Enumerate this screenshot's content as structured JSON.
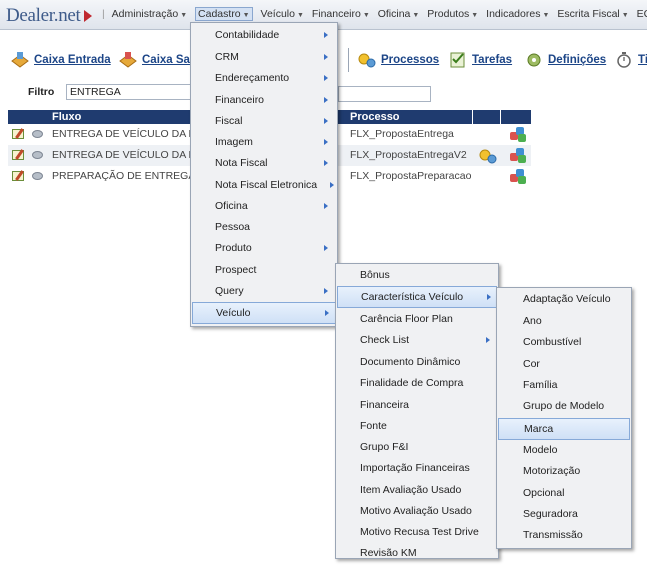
{
  "app": {
    "logo": "Dealer.net"
  },
  "nav": {
    "items": [
      {
        "label": "Administração",
        "caret": true
      },
      {
        "label": "Cadastro",
        "caret": true,
        "active": true
      },
      {
        "label": "Veículo",
        "caret": true
      },
      {
        "label": "Financeiro",
        "caret": true
      },
      {
        "label": "Oficina",
        "caret": true
      },
      {
        "label": "Produtos",
        "caret": true
      },
      {
        "label": "Indicadores",
        "caret": true
      },
      {
        "label": "Escrita Fiscal",
        "caret": true
      },
      {
        "label": "ECF",
        "caret": true
      }
    ]
  },
  "toolbar": {
    "caixa_entrada": "Caixa Entrada",
    "caixa_saida": "Caixa Sa",
    "processos": "Processos",
    "tarefas": "Tarefas",
    "definicoes": "Definições",
    "ti": "Ti"
  },
  "filter": {
    "label": "Filtro",
    "value": "ENTREGA"
  },
  "grid": {
    "headers": {
      "fluxo": "Fluxo",
      "processo": "Processo"
    },
    "rows": [
      {
        "fluxo": "ENTREGA DE VEÍCULO DA F",
        "processo": "FLX_PropostaEntrega",
        "gear": false
      },
      {
        "fluxo": "ENTREGA DE VEÍCULO DA F",
        "processo": "FLX_PropostaEntregaV2",
        "gear": true
      },
      {
        "fluxo": "PREPARAÇÃO DE ENTREGA",
        "processo": "FLX_PropostaPreparacao",
        "gear": false
      }
    ]
  },
  "menu_cadastro": {
    "items": [
      {
        "label": "Contabilidade",
        "sub": true
      },
      {
        "label": "CRM",
        "sub": true
      },
      {
        "label": "Endereçamento",
        "sub": true
      },
      {
        "label": "Financeiro",
        "sub": true
      },
      {
        "label": "Fiscal",
        "sub": true
      },
      {
        "label": "Imagem",
        "sub": true
      },
      {
        "label": "Nota Fiscal",
        "sub": true
      },
      {
        "label": "Nota Fiscal Eletronica",
        "sub": true
      },
      {
        "label": "Oficina",
        "sub": true
      },
      {
        "label": "Pessoa",
        "sub": false
      },
      {
        "label": "Produto",
        "sub": true
      },
      {
        "label": "Prospect",
        "sub": false
      },
      {
        "label": "Query",
        "sub": true
      },
      {
        "label": "Veículo",
        "sub": true,
        "highlighted": true
      }
    ]
  },
  "menu_veiculo": {
    "items": [
      {
        "label": "Bônus",
        "sub": false
      },
      {
        "label": "Característica Veículo",
        "sub": true,
        "highlighted": true
      },
      {
        "label": "Carência Floor Plan",
        "sub": false
      },
      {
        "label": "Check List",
        "sub": true
      },
      {
        "label": "Documento Dinâmico",
        "sub": false
      },
      {
        "label": "Finalidade de Compra",
        "sub": false
      },
      {
        "label": "Financeira",
        "sub": false
      },
      {
        "label": "Fonte",
        "sub": false
      },
      {
        "label": "Grupo F&I",
        "sub": false
      },
      {
        "label": "Importação Financeiras",
        "sub": false
      },
      {
        "label": "Item Avaliação Usado",
        "sub": false
      },
      {
        "label": "Motivo Avaliação Usado",
        "sub": false
      },
      {
        "label": "Motivo Recusa Test Drive",
        "sub": false
      },
      {
        "label": "Revisão KM",
        "sub": false
      }
    ]
  },
  "menu_caracteristica": {
    "items": [
      {
        "label": "Adaptação Veículo"
      },
      {
        "label": "Ano"
      },
      {
        "label": "Combustível"
      },
      {
        "label": "Cor"
      },
      {
        "label": "Família"
      },
      {
        "label": "Grupo de Modelo"
      },
      {
        "label": "Marca",
        "highlighted": true
      },
      {
        "label": "Modelo"
      },
      {
        "label": "Motorização"
      },
      {
        "label": "Opcional"
      },
      {
        "label": "Seguradora"
      },
      {
        "label": "Transmissão"
      }
    ]
  }
}
